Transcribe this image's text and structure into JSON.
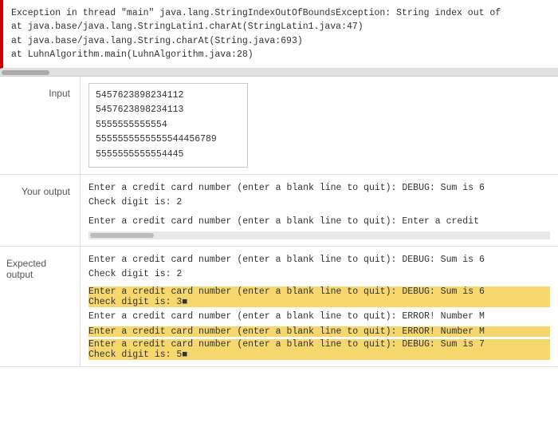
{
  "error": {
    "lines": [
      "Exception in thread \"main\" java.lang.StringIndexOutOfBoundsException: String index out of",
      "        at java.base/java.lang.StringLatin1.charAt(StringLatin1.java:47)",
      "        at java.base/java.lang.String.charAt(String.java:693)",
      "        at LuhnAlgorithm.main(LuhnAlgorithm.java:28)"
    ]
  },
  "input": {
    "label": "Input",
    "lines": [
      "5457623898234112",
      "5457623898234113",
      "5555555555554",
      "5555555555555544456789",
      "5555555555554445"
    ]
  },
  "your_output": {
    "label": "Your output",
    "blocks": [
      {
        "lines": [
          "Enter a credit card number (enter a blank line to quit): DEBUG: Sum is 6",
          "Check digit is: 2"
        ]
      },
      {
        "lines": [
          "Enter a credit card number (enter a blank line to quit): Enter a credit"
        ],
        "has_scroll": true
      }
    ]
  },
  "expected_output": {
    "label": "Expected output",
    "blocks": [
      {
        "type": "normal",
        "lines": [
          "Enter a credit card number (enter a blank line to quit): DEBUG: Sum is 6",
          "Check digit is: 2"
        ]
      },
      {
        "type": "gap"
      },
      {
        "type": "highlight",
        "lines": [
          "Enter a credit card number (enter a blank line to quit): DEBUG: Sum is 6",
          "Check digit is: 3■"
        ]
      },
      {
        "type": "small_gap"
      },
      {
        "type": "normal",
        "lines": [
          "Enter a credit card number (enter a blank line to quit): ERROR! Number M"
        ]
      },
      {
        "type": "small_gap"
      },
      {
        "type": "highlight2",
        "lines": [
          "Enter a credit card number (enter a blank line to quit): ERROR! Number M"
        ]
      },
      {
        "type": "small_gap"
      },
      {
        "type": "highlight3",
        "lines": [
          "Enter a credit card number (enter a blank line to quit): DEBUG: Sum is 7",
          "Check digit is: 5■"
        ]
      }
    ]
  }
}
